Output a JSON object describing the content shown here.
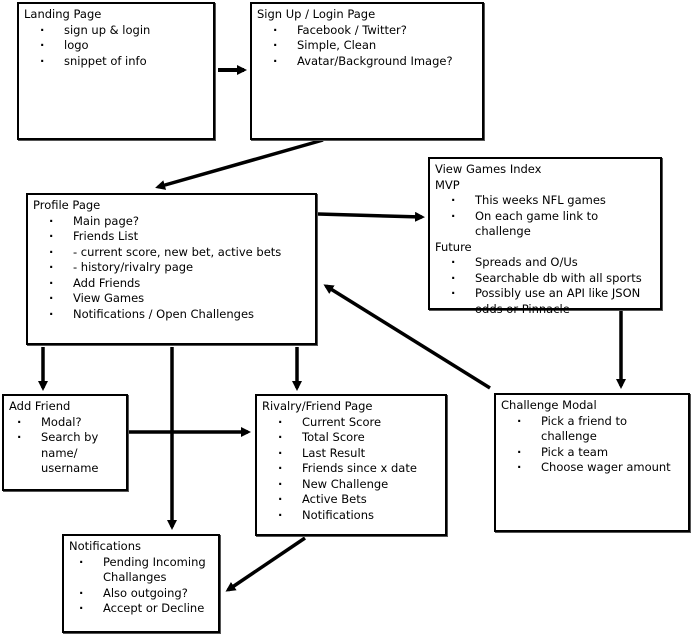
{
  "diagram": {
    "nodes": {
      "landing": {
        "title": "Landing Page",
        "items": [
          "sign up & login",
          "logo",
          "snippet of info"
        ]
      },
      "signup": {
        "title": "Sign Up / Login Page",
        "items": [
          "Facebook / Twitter?",
          "Simple, Clean",
          "Avatar/Background Image?"
        ]
      },
      "profile": {
        "title": "Profile Page",
        "items": [
          "Main page?",
          "Friends List",
          "- current score, new bet, active bets",
          "- history/rivalry page",
          "Add Friends",
          "View Games",
          "Notifications / Open Challenges"
        ]
      },
      "games": {
        "title": "View Games Index",
        "mvp_label": "MVP",
        "mvp_items": [
          "This weeks NFL games",
          "On each game link to challenge"
        ],
        "future_label": "Future",
        "future_items": [
          "Spreads and O/Us",
          "Searchable db with all sports",
          "Possibly use an API like JSON odds or Pinnacle"
        ]
      },
      "addfriend": {
        "title": "Add Friend",
        "items": [
          "Modal?",
          "Search by name/ username"
        ]
      },
      "rivalry": {
        "title": "Rivalry/Friend Page",
        "items": [
          "Current Score",
          "Total Score",
          "Last Result",
          "Friends since x date",
          "New Challenge",
          "Active Bets",
          "Notifications"
        ]
      },
      "challenge": {
        "title": "Challenge Modal",
        "items": [
          "Pick a friend to challenge",
          "Pick a team",
          "Choose wager amount"
        ]
      },
      "notifications": {
        "title": "Notifications",
        "items": [
          "Pending Incoming Challanges",
          "Also outgoing?",
          "Accept or Decline"
        ]
      }
    },
    "edges": [
      {
        "from": "landing",
        "to": "signup"
      },
      {
        "from": "signup",
        "to": "profile"
      },
      {
        "from": "profile",
        "to": "games"
      },
      {
        "from": "games",
        "to": "challenge"
      },
      {
        "from": "challenge",
        "to": "profile"
      },
      {
        "from": "profile",
        "to": "addfriend"
      },
      {
        "from": "profile",
        "to": "notifications"
      },
      {
        "from": "profile",
        "to": "rivalry"
      },
      {
        "from": "addfriend",
        "to": "rivalry"
      },
      {
        "from": "rivalry",
        "to": "notifications"
      }
    ]
  }
}
